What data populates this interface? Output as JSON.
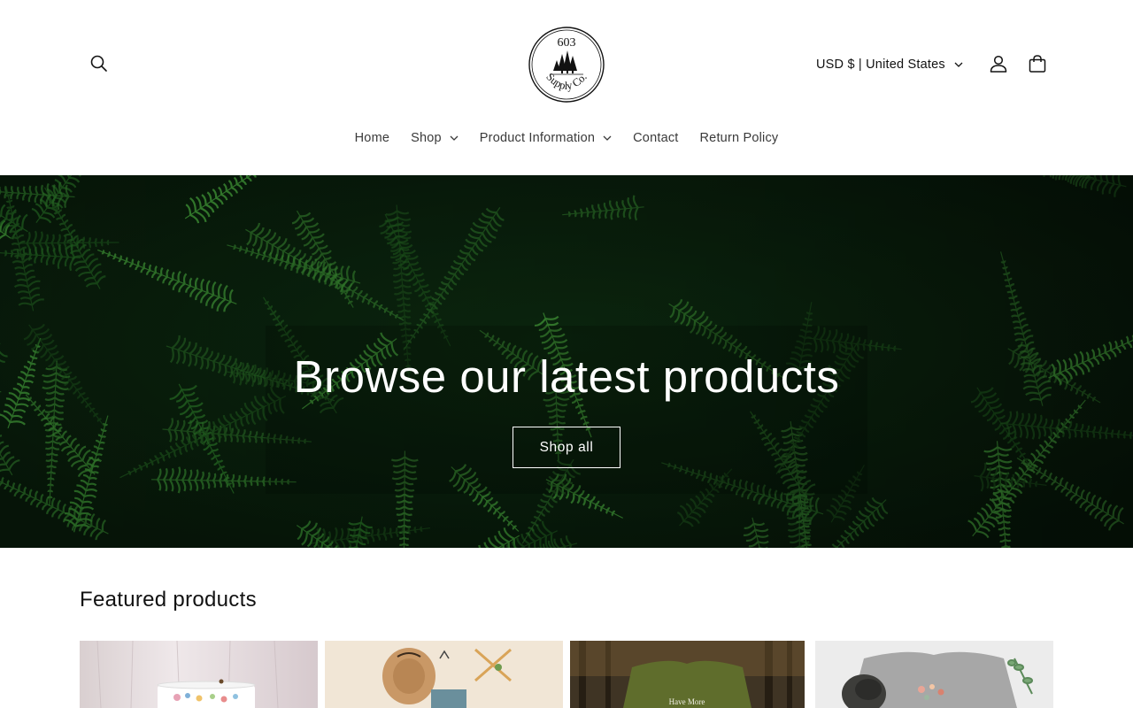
{
  "header": {
    "logo_text_top": "603",
    "logo_text_bottom": "Supply Co.",
    "currency_label": "USD $ | United States",
    "icons": [
      "search-icon",
      "account-icon",
      "cart-icon",
      "chevron-down-icon"
    ]
  },
  "nav": {
    "items": [
      {
        "label": "Home",
        "has_dropdown": false
      },
      {
        "label": "Shop",
        "has_dropdown": true
      },
      {
        "label": "Product Information",
        "has_dropdown": true
      },
      {
        "label": "Contact",
        "has_dropdown": false
      },
      {
        "label": "Return Policy",
        "has_dropdown": false
      }
    ]
  },
  "hero": {
    "title": "Browse our latest products",
    "button_label": "Shop all"
  },
  "featured": {
    "title": "Featured products",
    "card_text": "Have More"
  },
  "colors": {
    "text": "#121212",
    "nav_text": "#3a3a3a",
    "hero_bg": "#0b2410",
    "fern": "#2f7a2a",
    "white": "#ffffff"
  }
}
